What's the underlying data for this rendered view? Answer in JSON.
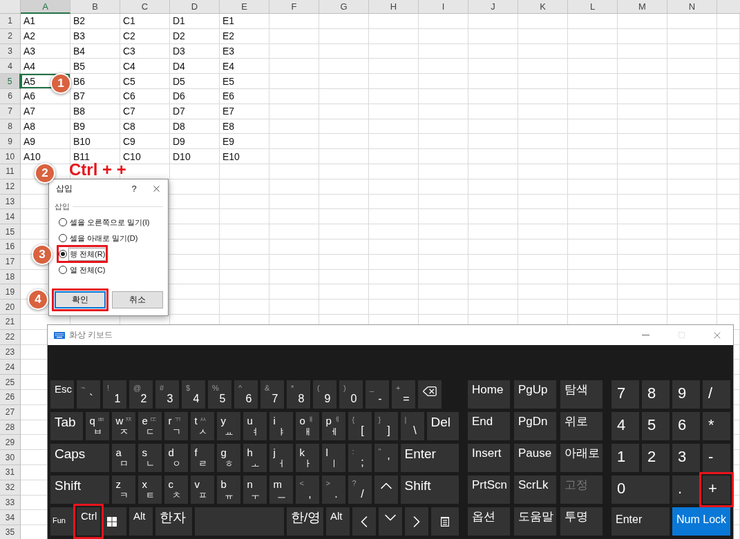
{
  "sheet": {
    "columns": [
      {
        "label": "A",
        "selected": true
      },
      {
        "label": "B",
        "selected": false
      },
      {
        "label": "C",
        "selected": false
      },
      {
        "label": "D",
        "selected": false
      },
      {
        "label": "E",
        "selected": false
      },
      {
        "label": "F",
        "selected": false
      },
      {
        "label": "G",
        "selected": false
      },
      {
        "label": "H",
        "selected": false
      },
      {
        "label": "I",
        "selected": false
      },
      {
        "label": "J",
        "selected": false
      },
      {
        "label": "K",
        "selected": false
      },
      {
        "label": "L",
        "selected": false
      },
      {
        "label": "M",
        "selected": false
      },
      {
        "label": "N",
        "selected": false
      }
    ],
    "rows": [
      {
        "label": "1",
        "selected": false,
        "cells": [
          {
            "text": "A1",
            "selected": false
          },
          {
            "text": "B2",
            "selected": false
          },
          {
            "text": "C1",
            "selected": false
          },
          {
            "text": "D1",
            "selected": false
          },
          {
            "text": "E1",
            "selected": false
          }
        ]
      },
      {
        "label": "2",
        "selected": false,
        "cells": [
          {
            "text": "A2",
            "selected": false
          },
          {
            "text": "B3",
            "selected": false
          },
          {
            "text": "C2",
            "selected": false
          },
          {
            "text": "D2",
            "selected": false
          },
          {
            "text": "E2",
            "selected": false
          }
        ]
      },
      {
        "label": "3",
        "selected": false,
        "cells": [
          {
            "text": "A3",
            "selected": false
          },
          {
            "text": "B4",
            "selected": false
          },
          {
            "text": "C3",
            "selected": false
          },
          {
            "text": "D3",
            "selected": false
          },
          {
            "text": "E3",
            "selected": false
          }
        ]
      },
      {
        "label": "4",
        "selected": false,
        "cells": [
          {
            "text": "A4",
            "selected": false
          },
          {
            "text": "B5",
            "selected": false
          },
          {
            "text": "C4",
            "selected": false
          },
          {
            "text": "D4",
            "selected": false
          },
          {
            "text": "E4",
            "selected": false
          }
        ]
      },
      {
        "label": "5",
        "selected": true,
        "cells": [
          {
            "text": "A5",
            "selected": true
          },
          {
            "text": "B6",
            "selected": false
          },
          {
            "text": "C5",
            "selected": false
          },
          {
            "text": "D5",
            "selected": false
          },
          {
            "text": "E5",
            "selected": false
          }
        ]
      },
      {
        "label": "6",
        "selected": false,
        "cells": [
          {
            "text": "A6",
            "selected": false
          },
          {
            "text": "B7",
            "selected": false
          },
          {
            "text": "C6",
            "selected": false
          },
          {
            "text": "D6",
            "selected": false
          },
          {
            "text": "E6",
            "selected": false
          }
        ]
      },
      {
        "label": "7",
        "selected": false,
        "cells": [
          {
            "text": "A7",
            "selected": false
          },
          {
            "text": "B8",
            "selected": false
          },
          {
            "text": "C7",
            "selected": false
          },
          {
            "text": "D7",
            "selected": false
          },
          {
            "text": "E7",
            "selected": false
          }
        ]
      },
      {
        "label": "8",
        "selected": false,
        "cells": [
          {
            "text": "A8",
            "selected": false
          },
          {
            "text": "B9",
            "selected": false
          },
          {
            "text": "C8",
            "selected": false
          },
          {
            "text": "D8",
            "selected": false
          },
          {
            "text": "E8",
            "selected": false
          }
        ]
      },
      {
        "label": "9",
        "selected": false,
        "cells": [
          {
            "text": "A9",
            "selected": false
          },
          {
            "text": "B10",
            "selected": false
          },
          {
            "text": "C9",
            "selected": false
          },
          {
            "text": "D9",
            "selected": false
          },
          {
            "text": "E9",
            "selected": false
          }
        ]
      },
      {
        "label": "10",
        "selected": false,
        "cells": [
          {
            "text": "A10",
            "selected": false
          },
          {
            "text": "B11",
            "selected": false
          },
          {
            "text": "C10",
            "selected": false
          },
          {
            "text": "D10",
            "selected": false
          },
          {
            "text": "E10",
            "selected": false
          }
        ]
      },
      {
        "label": "11",
        "selected": false
      },
      {
        "label": "12",
        "selected": false
      },
      {
        "label": "13",
        "selected": false
      },
      {
        "label": "14",
        "selected": false
      },
      {
        "label": "15",
        "selected": false
      },
      {
        "label": "16",
        "selected": false
      },
      {
        "label": "17",
        "selected": false
      },
      {
        "label": "18",
        "selected": false
      },
      {
        "label": "19",
        "selected": false
      },
      {
        "label": "20",
        "selected": false
      },
      {
        "label": "21",
        "selected": false
      },
      {
        "label": "22",
        "selected": false
      },
      {
        "label": "23",
        "selected": false
      },
      {
        "label": "24",
        "selected": false
      },
      {
        "label": "25",
        "selected": false
      },
      {
        "label": "26",
        "selected": false
      },
      {
        "label": "27",
        "selected": false
      },
      {
        "label": "28",
        "selected": false
      },
      {
        "label": "29",
        "selected": false
      },
      {
        "label": "30",
        "selected": false
      },
      {
        "label": "31",
        "selected": false
      },
      {
        "label": "32",
        "selected": false
      },
      {
        "label": "33",
        "selected": false
      },
      {
        "label": "34",
        "selected": false
      },
      {
        "label": "35",
        "selected": false
      }
    ]
  },
  "dialog": {
    "title": "삽입",
    "help": "?",
    "group_label": "삽입",
    "options": [
      {
        "label": "셀을 오른쪽으로 밀기(I)",
        "selected": false,
        "highlighted": false
      },
      {
        "label": "셀을 아래로 밀기(D)",
        "selected": false,
        "highlighted": false
      },
      {
        "label": "행 전체(R)",
        "selected": true,
        "highlighted": true
      },
      {
        "label": "열 전체(C)",
        "selected": false,
        "highlighted": false
      }
    ],
    "buttons": [
      {
        "label": "확인",
        "default": true,
        "highlighted": true
      },
      {
        "label": "취소",
        "default": false,
        "highlighted": false
      }
    ]
  },
  "keyboard": {
    "title": "화상 키보드",
    "main_rows": [
      {
        "keys": [
          {
            "kind": "label",
            "label": "Esc",
            "highlighted": false
          },
          {
            "kind": "char",
            "shift": "~",
            "main": "`",
            "highlighted": false
          },
          {
            "kind": "char",
            "shift": "!",
            "main": "1",
            "highlighted": false
          },
          {
            "kind": "char",
            "shift": "@",
            "main": "2",
            "highlighted": false
          },
          {
            "kind": "char",
            "shift": "#",
            "main": "3",
            "highlighted": false
          },
          {
            "kind": "char",
            "shift": "$",
            "main": "4",
            "highlighted": false
          },
          {
            "kind": "char",
            "shift": "%",
            "main": "5",
            "highlighted": false
          },
          {
            "kind": "char",
            "shift": "^",
            "main": "6",
            "highlighted": false
          },
          {
            "kind": "char",
            "shift": "&",
            "main": "7",
            "highlighted": false
          },
          {
            "kind": "char",
            "shift": "*",
            "main": "8",
            "highlighted": false
          },
          {
            "kind": "char",
            "shift": "(",
            "main": "9",
            "highlighted": false
          },
          {
            "kind": "char",
            "shift": ")",
            "main": "0",
            "highlighted": false
          },
          {
            "kind": "char",
            "shift": "_",
            "main": "-",
            "highlighted": false
          },
          {
            "kind": "char",
            "shift": "+",
            "main": "=",
            "highlighted": false
          },
          {
            "kind": "backspace",
            "highlighted": false
          }
        ]
      },
      {
        "keys": [
          {
            "kind": "wide",
            "label": "Tab",
            "highlighted": false
          },
          {
            "kind": "letter",
            "latin": "q",
            "shift": "ㅃ",
            "main": "ㅂ",
            "highlighted": false
          },
          {
            "kind": "letter",
            "latin": "w",
            "shift": "ㅉ",
            "main": "ㅈ",
            "highlighted": false
          },
          {
            "kind": "letter",
            "latin": "e",
            "shift": "ㄸ",
            "main": "ㄷ",
            "highlighted": false
          },
          {
            "kind": "letter",
            "latin": "r",
            "shift": "ㄲ",
            "main": "ㄱ",
            "highlighted": false
          },
          {
            "kind": "letter",
            "latin": "t",
            "shift": "ㅆ",
            "main": "ㅅ",
            "highlighted": false
          },
          {
            "kind": "letter",
            "latin": "y",
            "main": "ㅛ",
            "highlighted": false
          },
          {
            "kind": "letter",
            "latin": "u",
            "main": "ㅕ",
            "highlighted": false
          },
          {
            "kind": "letter",
            "latin": "i",
            "main": "ㅑ",
            "highlighted": false
          },
          {
            "kind": "letter",
            "latin": "o",
            "shift": "ㅒ",
            "main": "ㅐ",
            "highlighted": false
          },
          {
            "kind": "letter",
            "latin": "p",
            "shift": "ㅖ",
            "main": "ㅔ",
            "highlighted": false
          },
          {
            "kind": "char",
            "shift": "{",
            "main": "[",
            "highlighted": false
          },
          {
            "kind": "char",
            "shift": "}",
            "main": "]",
            "highlighted": false
          },
          {
            "kind": "char",
            "shift": "|",
            "main": "\\",
            "highlighted": false
          },
          {
            "kind": "wide",
            "label": "Del",
            "highlighted": false
          }
        ]
      },
      {
        "keys": [
          {
            "kind": "wide",
            "label": "Caps",
            "highlighted": false
          },
          {
            "kind": "letter",
            "latin": "a",
            "main": "ㅁ",
            "highlighted": false
          },
          {
            "kind": "letter",
            "latin": "s",
            "main": "ㄴ",
            "highlighted": false
          },
          {
            "kind": "letter",
            "latin": "d",
            "main": "ㅇ",
            "highlighted": false
          },
          {
            "kind": "letter",
            "latin": "f",
            "main": "ㄹ",
            "highlighted": false
          },
          {
            "kind": "letter",
            "latin": "g",
            "main": "ㅎ",
            "highlighted": false
          },
          {
            "kind": "letter",
            "latin": "h",
            "main": "ㅗ",
            "highlighted": false
          },
          {
            "kind": "letter",
            "latin": "j",
            "main": "ㅓ",
            "highlighted": false
          },
          {
            "kind": "letter",
            "latin": "k",
            "main": "ㅏ",
            "highlighted": false
          },
          {
            "kind": "letter",
            "latin": "l",
            "main": "ㅣ",
            "highlighted": false
          },
          {
            "kind": "char",
            "shift": ":",
            "main": ";",
            "highlighted": false
          },
          {
            "kind": "char",
            "shift": "\"",
            "main": "'",
            "highlighted": false
          },
          {
            "kind": "wide",
            "label": "Enter",
            "highlighted": false
          }
        ]
      },
      {
        "keys": [
          {
            "kind": "wide",
            "label": "Shift",
            "highlighted": false
          },
          {
            "kind": "letter",
            "latin": "z",
            "main": "ㅋ",
            "highlighted": false
          },
          {
            "kind": "letter",
            "latin": "x",
            "main": "ㅌ",
            "highlighted": false
          },
          {
            "kind": "letter",
            "latin": "c",
            "main": "ㅊ",
            "highlighted": false
          },
          {
            "kind": "letter",
            "latin": "v",
            "main": "ㅍ",
            "highlighted": false
          },
          {
            "kind": "letter",
            "latin": "b",
            "main": "ㅠ",
            "highlighted": false
          },
          {
            "kind": "letter",
            "latin": "n",
            "main": "ㅜ",
            "highlighted": false
          },
          {
            "kind": "letter",
            "latin": "m",
            "main": "ㅡ",
            "highlighted": false
          },
          {
            "kind": "char",
            "shift": "<",
            "main": ",",
            "highlighted": false
          },
          {
            "kind": "char",
            "shift": ">",
            "main": ".",
            "highlighted": false
          },
          {
            "kind": "char",
            "shift": "?",
            "main": "/",
            "highlighted": false
          },
          {
            "kind": "up",
            "highlighted": false
          },
          {
            "kind": "wide",
            "label": "Shift",
            "highlighted": false
          }
        ]
      },
      {
        "keys": [
          {
            "kind": "small",
            "label": "Fun",
            "highlighted": false
          },
          {
            "kind": "label",
            "label": "Ctrl",
            "highlighted": true
          },
          {
            "kind": "win",
            "highlighted": false
          },
          {
            "kind": "label",
            "label": "Alt",
            "highlighted": false
          },
          {
            "kind": "mid",
            "label": "한자",
            "highlighted": false
          },
          {
            "kind": "space",
            "highlighted": false
          },
          {
            "kind": "mid",
            "label": "한/영",
            "highlighted": false
          },
          {
            "kind": "label",
            "label": "Alt",
            "highlighted": false
          },
          {
            "kind": "left",
            "highlighted": false
          },
          {
            "kind": "down",
            "highlighted": false
          },
          {
            "kind": "right",
            "highlighted": false
          },
          {
            "kind": "menu",
            "highlighted": false
          }
        ]
      }
    ],
    "nav_rows": [
      {
        "keys": [
          {
            "label": "Home",
            "disabled": false
          },
          {
            "label": "PgUp",
            "disabled": false
          },
          {
            "label": "탐색",
            "disabled": false
          }
        ]
      },
      {
        "keys": [
          {
            "label": "End",
            "disabled": false
          },
          {
            "label": "PgDn",
            "disabled": false
          },
          {
            "label": "위로",
            "disabled": false
          }
        ]
      },
      {
        "keys": [
          {
            "label": "Insert",
            "disabled": false
          },
          {
            "label": "Pause",
            "disabled": false
          },
          {
            "label": "아래로",
            "disabled": false
          }
        ]
      },
      {
        "keys": [
          {
            "label": "PrtScn",
            "disabled": false
          },
          {
            "label": "ScrLk",
            "disabled": false
          },
          {
            "label": "고정",
            "disabled": true
          }
        ]
      },
      {
        "keys": [
          {
            "label": "옵션",
            "disabled": false
          },
          {
            "label": "도움말",
            "disabled": false
          },
          {
            "label": "투명",
            "disabled": false
          }
        ]
      }
    ],
    "numpad_rows": [
      {
        "keys": [
          {
            "kind": "num",
            "label": "7",
            "on": false,
            "highlighted": false
          },
          {
            "kind": "num",
            "label": "8",
            "on": false,
            "highlighted": false
          },
          {
            "kind": "num",
            "label": "9",
            "on": false,
            "highlighted": false
          },
          {
            "kind": "num",
            "label": "/",
            "on": false,
            "highlighted": false
          }
        ]
      },
      {
        "keys": [
          {
            "kind": "num",
            "label": "4",
            "on": false,
            "highlighted": false
          },
          {
            "kind": "num",
            "label": "5",
            "on": false,
            "highlighted": false
          },
          {
            "kind": "num",
            "label": "6",
            "on": false,
            "highlighted": false
          },
          {
            "kind": "num",
            "label": "*",
            "on": false,
            "highlighted": false
          }
        ]
      },
      {
        "keys": [
          {
            "kind": "num",
            "label": "1",
            "on": false,
            "highlighted": false
          },
          {
            "kind": "num",
            "label": "2",
            "on": false,
            "highlighted": false
          },
          {
            "kind": "num",
            "label": "3",
            "on": false,
            "highlighted": false
          },
          {
            "kind": "num",
            "label": "-",
            "on": false,
            "highlighted": false
          }
        ]
      },
      {
        "keys": [
          {
            "kind": "num-wide",
            "label": "0",
            "on": false,
            "highlighted": false
          },
          {
            "kind": "num",
            "label": ".",
            "on": false,
            "highlighted": false
          },
          {
            "kind": "num",
            "label": "+",
            "on": false,
            "highlighted": true
          }
        ]
      },
      {
        "keys": [
          {
            "kind": "label-wide",
            "label": "Enter",
            "on": false,
            "highlighted": false
          },
          {
            "kind": "label-wide",
            "label": "Num Lock",
            "on": true,
            "highlighted": false
          }
        ]
      }
    ]
  },
  "annotations": {
    "steps": [
      "1",
      "2",
      "3",
      "4"
    ],
    "callout": "Ctrl + +"
  }
}
